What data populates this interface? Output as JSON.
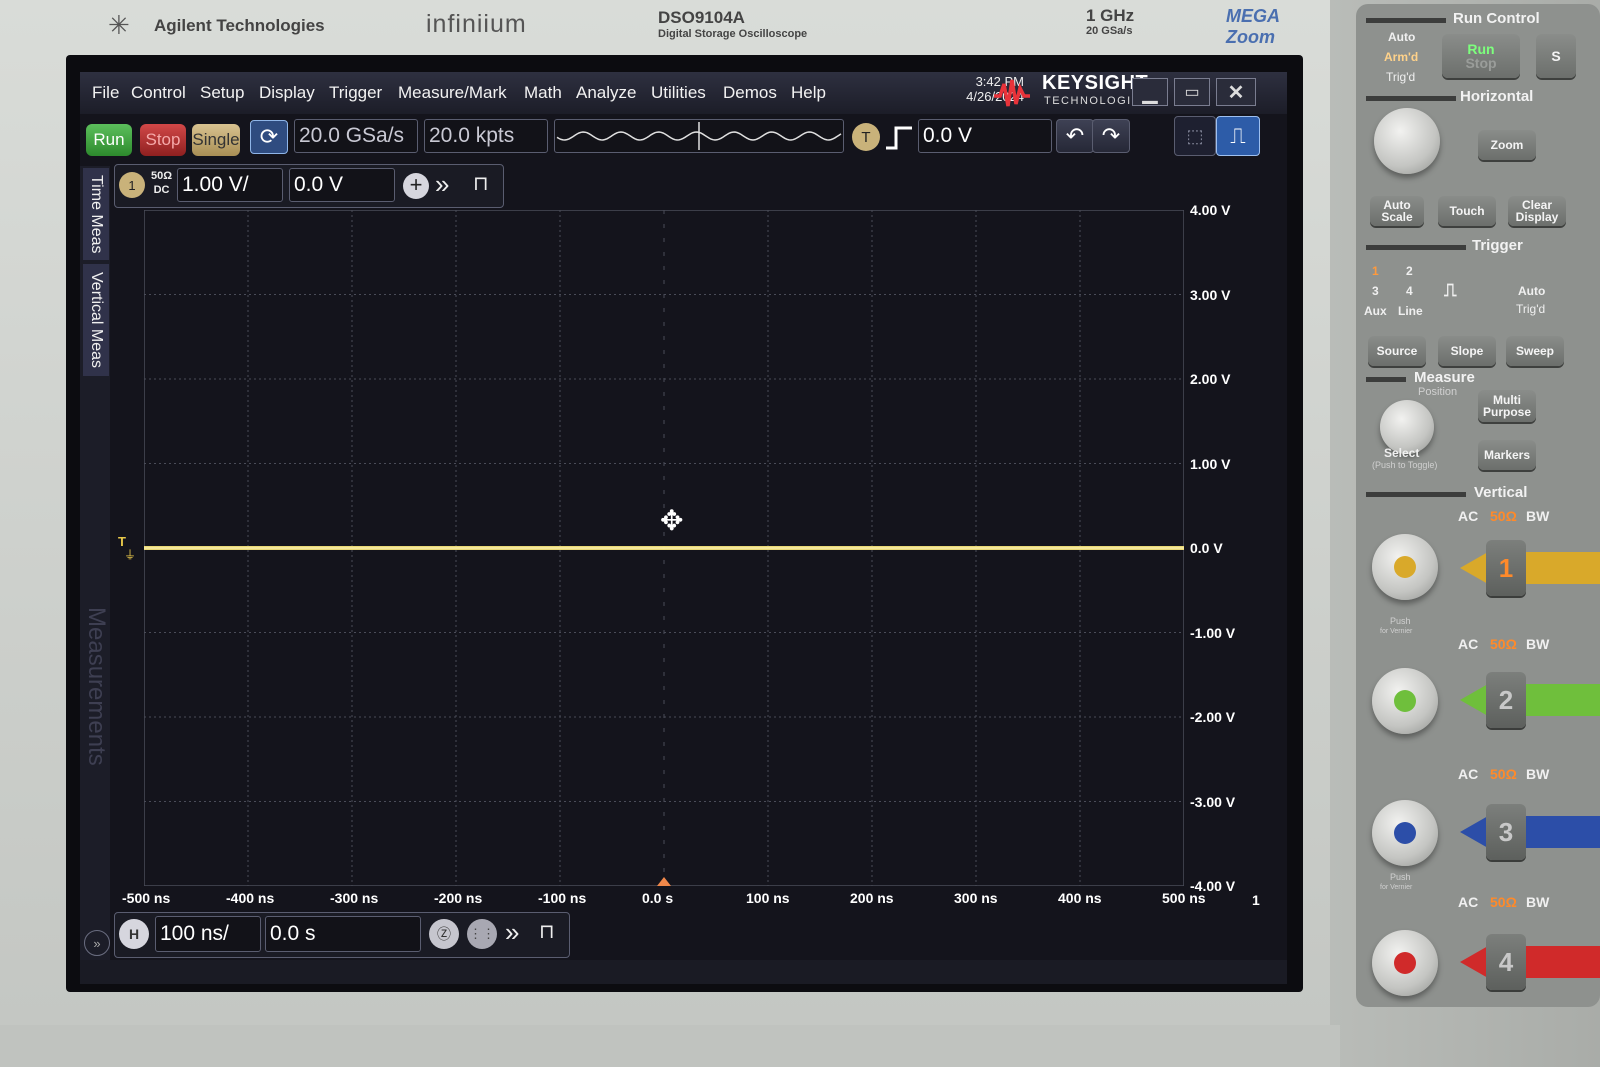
{
  "instrument": {
    "brand": "Agilent Technologies",
    "series": "infiniium",
    "model": "DSO9104A",
    "model_desc": "Digital Storage Oscilloscope",
    "bandwidth": "1 GHz",
    "sample_rate": "20 GSa/s",
    "megazoom": "MEGA Zoom"
  },
  "menu": [
    "File",
    "Control",
    "Setup",
    "Display",
    "Trigger",
    "Measure/Mark",
    "Math",
    "Analyze",
    "Utilities",
    "Demos",
    "Help"
  ],
  "status": {
    "time": "3:42 PM",
    "date": "4/26/2024"
  },
  "keysight": {
    "name": "KEYSIGHT",
    "sub": "TECHNOLOGIES"
  },
  "toolbar": {
    "run": "Run",
    "stop": "Stop",
    "single": "Single",
    "sample_rate": "20.0 GSa/s",
    "memory_depth": "20.0 kpts",
    "trigger_badge": "T",
    "trigger_level": "0.0 V"
  },
  "channel": {
    "badge": "1",
    "coupling_top": "50Ω",
    "coupling_bottom": "DC",
    "scale": "1.00 V/",
    "offset": "0.0 V"
  },
  "side_tabs": {
    "time_meas": "Time Meas",
    "vertical_meas": "Vertical Meas",
    "measurements": "Measurements"
  },
  "timebase": {
    "badge": "H",
    "scale": "100 ns/",
    "position": "0.0 s"
  },
  "colors": {
    "trace": "#f4e37a",
    "channel1": "#e8c84a",
    "grid": "#4a4c58",
    "background": "#14141c"
  },
  "chart_data": {
    "type": "line",
    "title": "",
    "xlabel": "",
    "ylabel": "",
    "x_ticks": [
      "-500 ns",
      "-400 ns",
      "-300 ns",
      "-200 ns",
      "-100 ns",
      "0.0 s",
      "100 ns",
      "200 ns",
      "300 ns",
      "400 ns",
      "500 ns"
    ],
    "y_ticks": [
      "4.00 V",
      "3.00 V",
      "2.00 V",
      "1.00 V",
      "0.0 V",
      "-1.00 V",
      "-2.00 V",
      "-3.00 V",
      "-4.00 V"
    ],
    "xlim": [
      -500,
      500
    ],
    "ylim": [
      -4,
      4
    ],
    "grid": true,
    "series": [
      {
        "x": [
          -500,
          -250,
          0,
          250,
          500
        ],
        "values": [
          0,
          0,
          0,
          0,
          0
        ]
      }
    ],
    "trigger_marker": "T",
    "page_indicator": "1"
  },
  "panel": {
    "run_control": "Run Control",
    "auto": "Auto",
    "armd": "Arm'd",
    "trigd": "Trig'd",
    "run": "Run",
    "stop": "Stop",
    "s_cut": "S",
    "horizontal": "Horizontal",
    "zoom": "Zoom",
    "auto_scale": "Auto Scale",
    "touch": "Touch",
    "clear_display": "Clear Display",
    "trigger": "Trigger",
    "trig_sources": [
      "1",
      "2",
      "3",
      "4",
      "Aux",
      "Line"
    ],
    "auto2": "Auto",
    "trigd2": "Trig'd",
    "source": "Source",
    "slope": "Slope",
    "sweep": "Sweep",
    "measure": "Measure",
    "position": "Position",
    "select": "Select",
    "push_toggle": "(Push to Toggle)",
    "multi_purpose": "Multi Purpose",
    "markers": "Markers",
    "vertical": "Vertical",
    "ac": "AC",
    "ohm": "50Ω",
    "bw": "BW",
    "push": "Push",
    "for_vernier": "for Vernier",
    "channels": [
      "1",
      "2",
      "3",
      "4"
    ]
  }
}
